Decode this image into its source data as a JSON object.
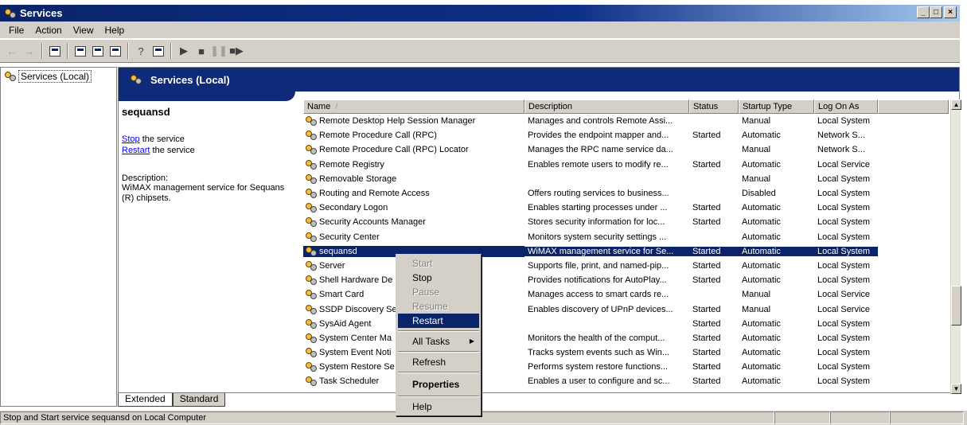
{
  "window": {
    "title": "Services"
  },
  "menu": [
    "File",
    "Action",
    "View",
    "Help"
  ],
  "tree": {
    "root": "Services (Local)"
  },
  "header": {
    "title": "Services (Local)"
  },
  "details": {
    "service_name": "sequansd",
    "stop_link": "Stop",
    "stop_suffix": " the service",
    "restart_link": "Restart",
    "restart_suffix": " the service",
    "description_label": "Description:",
    "description_text": "WiMAX management service for Sequans (R) chipsets."
  },
  "columns": {
    "name": "Name",
    "sort_glyph": "/",
    "description": "Description",
    "status": "Status",
    "startup": "Startup Type",
    "logon": "Log On As"
  },
  "rows": [
    {
      "name": "Remote Desktop Help Session Manager",
      "desc": "Manages and controls Remote Assi...",
      "status": "",
      "startup": "Manual",
      "logon": "Local System"
    },
    {
      "name": "Remote Procedure Call (RPC)",
      "desc": "Provides the endpoint mapper and...",
      "status": "Started",
      "startup": "Automatic",
      "logon": "Network S..."
    },
    {
      "name": "Remote Procedure Call (RPC) Locator",
      "desc": "Manages the RPC name service da...",
      "status": "",
      "startup": "Manual",
      "logon": "Network S..."
    },
    {
      "name": "Remote Registry",
      "desc": "Enables remote users to modify re...",
      "status": "Started",
      "startup": "Automatic",
      "logon": "Local Service"
    },
    {
      "name": "Removable Storage",
      "desc": "",
      "status": "",
      "startup": "Manual",
      "logon": "Local System"
    },
    {
      "name": "Routing and Remote Access",
      "desc": "Offers routing services to business...",
      "status": "",
      "startup": "Disabled",
      "logon": "Local System"
    },
    {
      "name": "Secondary Logon",
      "desc": "Enables starting processes under ...",
      "status": "Started",
      "startup": "Automatic",
      "logon": "Local System"
    },
    {
      "name": "Security Accounts Manager",
      "desc": "Stores security information for loc...",
      "status": "Started",
      "startup": "Automatic",
      "logon": "Local System"
    },
    {
      "name": "Security Center",
      "desc": "Monitors system security settings ...",
      "status": "",
      "startup": "Automatic",
      "logon": "Local System"
    },
    {
      "name": "sequansd",
      "desc": "WiMAX management service for Se...",
      "status": "Started",
      "startup": "Automatic",
      "logon": "Local System"
    },
    {
      "name": "Server",
      "desc": "Supports file, print, and named-pip...",
      "status": "Started",
      "startup": "Automatic",
      "logon": "Local System"
    },
    {
      "name": "Shell Hardware De",
      "desc": "Provides notifications for AutoPlay...",
      "status": "Started",
      "startup": "Automatic",
      "logon": "Local System"
    },
    {
      "name": "Smart Card",
      "desc": "Manages access to smart cards re...",
      "status": "",
      "startup": "Manual",
      "logon": "Local Service"
    },
    {
      "name": "SSDP Discovery Se",
      "desc": "Enables discovery of UPnP devices...",
      "status": "Started",
      "startup": "Manual",
      "logon": "Local Service"
    },
    {
      "name": "SysAid Agent",
      "desc": "",
      "status": "Started",
      "startup": "Automatic",
      "logon": "Local System"
    },
    {
      "name": "System Center Ma",
      "desc": "Monitors the health of the comput...",
      "status": "Started",
      "startup": "Automatic",
      "logon": "Local System"
    },
    {
      "name": "System Event Noti",
      "desc": "Tracks system events such as Win...",
      "status": "Started",
      "startup": "Automatic",
      "logon": "Local System"
    },
    {
      "name": "System Restore Se",
      "desc": "Performs system restore functions...",
      "status": "Started",
      "startup": "Automatic",
      "logon": "Local System"
    },
    {
      "name": "Task Scheduler",
      "desc": "Enables a user to configure and sc...",
      "status": "Started",
      "startup": "Automatic",
      "logon": "Local System"
    }
  ],
  "selected_row_name": "sequansd",
  "context_menu": {
    "start": "Start",
    "stop": "Stop",
    "pause": "Pause",
    "resume": "Resume",
    "restart": "Restart",
    "all_tasks": "All Tasks",
    "refresh": "Refresh",
    "properties": "Properties",
    "help": "Help"
  },
  "tabs": {
    "extended": "Extended",
    "standard": "Standard"
  },
  "status": {
    "text": "Stop and Start service sequansd on Local Computer"
  },
  "colors": {
    "title_bar": "#0a246a",
    "header_band": "#0e2a78",
    "selection": "#0a246a",
    "link": "#0000ff",
    "chrome": "#d4d0c8"
  },
  "icons": [
    "services-app-icon",
    "back-arrow-icon",
    "forward-arrow-icon",
    "show-hide-tree-icon",
    "properties-icon",
    "refresh-icon",
    "export-list-icon",
    "help-icon",
    "console-icon",
    "play-icon",
    "stop-icon",
    "pause-icon",
    "restart-icon",
    "gear-icon"
  ]
}
